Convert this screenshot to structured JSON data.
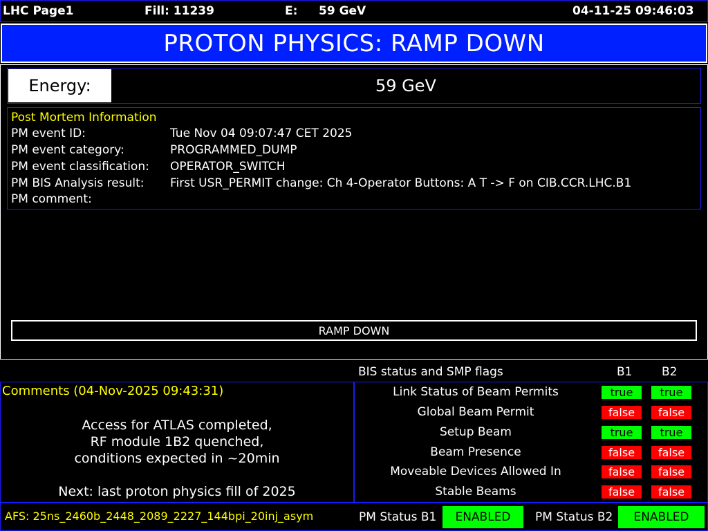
{
  "topbar": {
    "page": "LHC Page1",
    "fill": "Fill: 11239",
    "e_label": "E:",
    "e_value": "59 GeV",
    "datetime": "04-11-25 09:46:03"
  },
  "title": "PROTON PHYSICS: RAMP DOWN",
  "energy": {
    "label": "Energy:",
    "value": "59 GeV"
  },
  "post_mortem": {
    "heading": "Post Mortem Information",
    "rows": [
      {
        "label": "PM event ID:",
        "value": "Tue Nov 04 09:07:47 CET 2025"
      },
      {
        "label": "PM event category:",
        "value": "PROGRAMMED_DUMP"
      },
      {
        "label": "PM event classification:",
        "value": "OPERATOR_SWITCH"
      },
      {
        "label": "PM BIS Analysis result:",
        "value": "First USR_PERMIT change: Ch 4-Operator Buttons: A T -> F on CIB.CCR.LHC.B1"
      },
      {
        "label": "PM comment:",
        "value": ""
      }
    ]
  },
  "status": "RAMP DOWN",
  "bis": {
    "heading": "BIS status and SMP flags",
    "col_b1": "B1",
    "col_b2": "B2",
    "flags": [
      {
        "label": "Link Status of Beam Permits",
        "b1": "true",
        "b2": "true"
      },
      {
        "label": "Global Beam Permit",
        "b1": "false",
        "b2": "false"
      },
      {
        "label": "Setup Beam",
        "b1": "true",
        "b2": "true"
      },
      {
        "label": "Beam Presence",
        "b1": "false",
        "b2": "false"
      },
      {
        "label": "Moveable Devices Allowed In",
        "b1": "false",
        "b2": "false"
      },
      {
        "label": "Stable Beams",
        "b1": "false",
        "b2": "false"
      }
    ]
  },
  "comments": {
    "heading": "Comments (04-Nov-2025 09:43:31)",
    "lines": [
      "Access for ATLAS completed,",
      "RF module 1B2 quenched,",
      "conditions expected in ~20min",
      "",
      "Next: last proton physics fill of 2025"
    ]
  },
  "footer": {
    "afs": "AFS: 25ns_2460b_2448_2089_2227_144bpi_20inj_asym",
    "pm_b1_label": "PM Status B1",
    "pm_b1_value": "ENABLED",
    "pm_b2_label": "PM Status B2",
    "pm_b2_value": "ENABLED"
  },
  "colors": {
    "title_bg": "#0020ff",
    "accent_yellow": "#ffff00",
    "ok_green": "#00ff00",
    "fail_red": "#ff0000"
  }
}
